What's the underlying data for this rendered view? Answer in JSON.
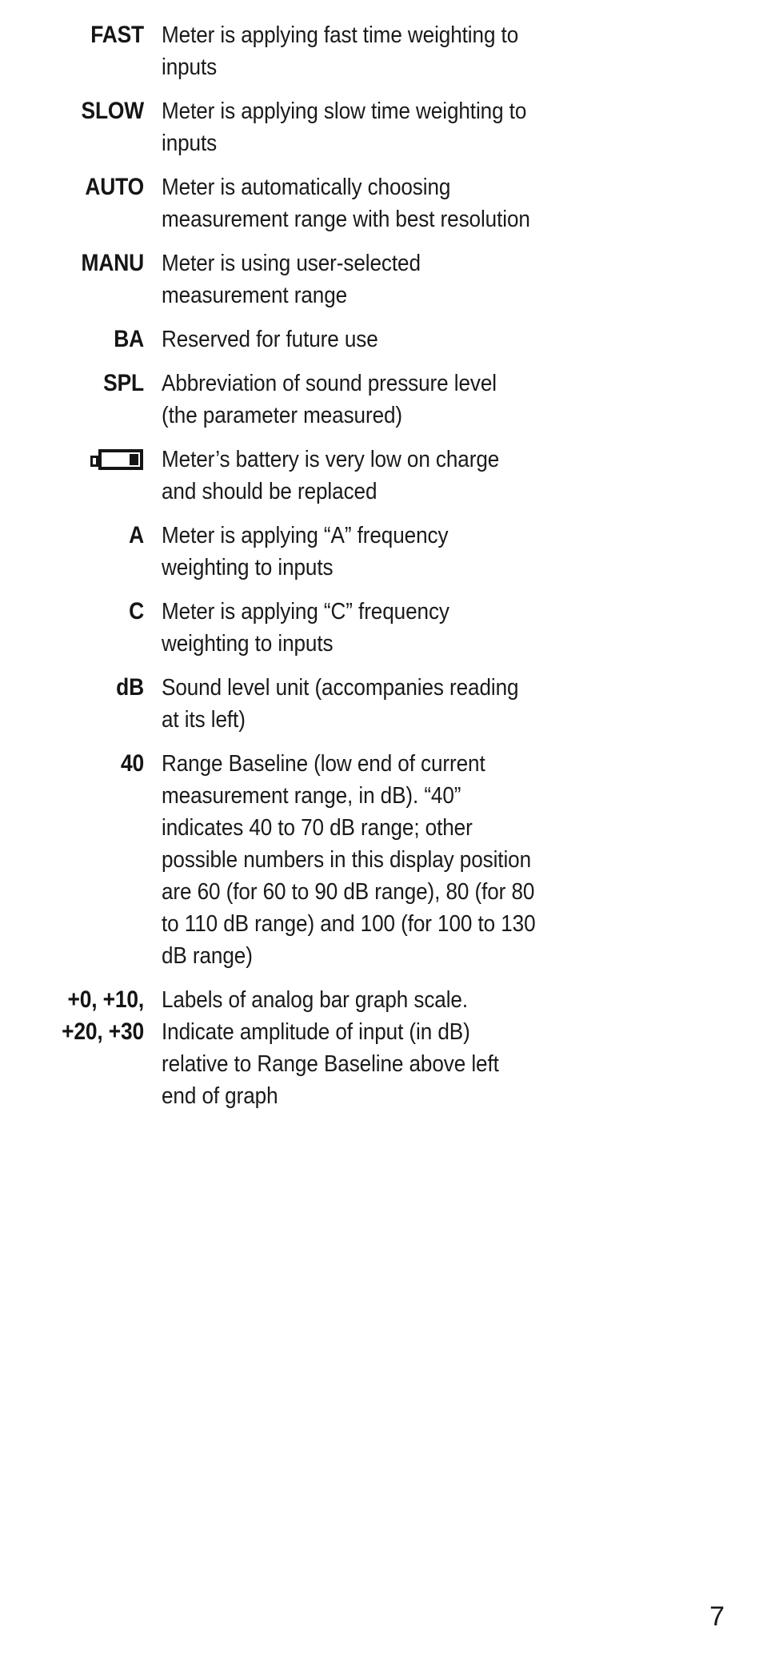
{
  "document": {
    "type": "manual-page",
    "page_number": "7",
    "background_color": "#ffffff",
    "text_color": "#1a1a1a"
  },
  "glossary": {
    "entries": [
      {
        "term": "FAST",
        "term_kind": "text",
        "description": "Meter is applying fast time weighting to inputs"
      },
      {
        "term": "SLOW",
        "term_kind": "text",
        "description": "Meter is applying slow time weighting to inputs"
      },
      {
        "term": "AUTO",
        "term_kind": "text",
        "description": "Meter is automatically choosing measurement range with best resolution"
      },
      {
        "term": "MANU",
        "term_kind": "text",
        "description": "Meter is using user-selected measurement range"
      },
      {
        "term": "BA",
        "term_kind": "text",
        "description": "Reserved for future use"
      },
      {
        "term": "SPL",
        "term_kind": "text",
        "description": "Abbreviation of sound pressure level (the parameter measured)"
      },
      {
        "term": "",
        "term_kind": "icon",
        "icon": "battery-low-icon",
        "description": "Meter’s battery is very low on charge and should be replaced"
      },
      {
        "term": "A",
        "term_kind": "text",
        "description": "Meter is applying “A” frequency weighting to inputs"
      },
      {
        "term": "C",
        "term_kind": "text",
        "description": "Meter is applying “C” frequency weighting to inputs"
      },
      {
        "term": "dB",
        "term_kind": "text",
        "description": "Sound level unit (accompanies reading at its left)"
      },
      {
        "term": "40",
        "term_kind": "text",
        "description": "Range Baseline (low end of current measurement range, in dB). “40” indicates 40 to 70 dB range; other possible numbers in this display position are 60 (for 60 to 90 dB range), 80 (for 80 to 110 dB range) and 100 (for 100 to 130 dB range)"
      },
      {
        "term": "+0, +10,",
        "term_line2": "+20, +30",
        "term_kind": "text-two-line",
        "description": "Labels of analog bar graph scale. Indicate amplitude of input (in dB) relative to Range Baseline above left end of graph"
      }
    ]
  }
}
